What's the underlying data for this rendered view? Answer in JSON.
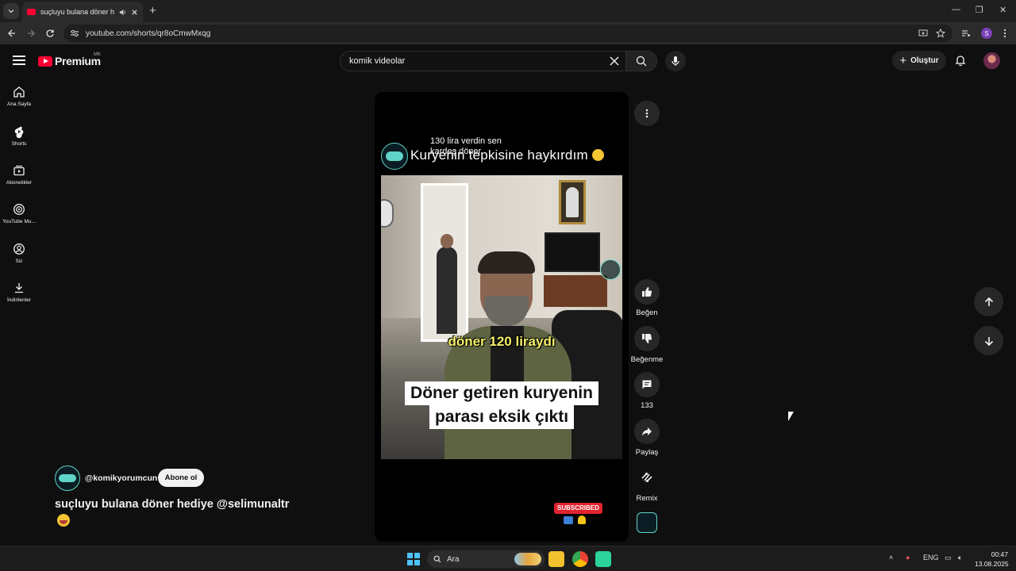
{
  "browser": {
    "tab_title": "suçluyu bulana döner hediy",
    "url": "youtube.com/shorts/qr8oCmwMxqg",
    "profile_initial": "S"
  },
  "header": {
    "brand": "Premium",
    "region": "MK",
    "search_value": "komik videolar",
    "create_label": "Oluştur"
  },
  "sidebar": {
    "items": [
      {
        "label": "Ana Sayfa",
        "icon": "home-icon"
      },
      {
        "label": "Shorts",
        "icon": "shorts-icon"
      },
      {
        "label": "Abonelikler",
        "icon": "subscriptions-icon"
      },
      {
        "label": "YouTube Mu...",
        "icon": "youtube-music-icon"
      },
      {
        "label": "Siz",
        "icon": "you-icon"
      },
      {
        "label": "İndirilenler",
        "icon": "downloads-icon"
      }
    ]
  },
  "video": {
    "overlay_text": "130 lira verdin sen kardeş döner",
    "title_text": "Kuryenin tepkisine haykırdım",
    "caption_yellow": "döner 120 liraydı",
    "caption_line1": "Döner getiren kuryenin",
    "caption_line2": "parası eksik çıktı",
    "subscribed_label": "SUBSCRIBED"
  },
  "actions": {
    "like_label": "Beğen",
    "dislike_label": "Beğenme",
    "comments_count": "133",
    "share_label": "Paylaş",
    "remix_label": "Remix"
  },
  "channel": {
    "handle": "@komikyorumcun",
    "subscribe_label": "Abone ol",
    "description": "suçluyu bulana döner hediye @selimunaltr"
  },
  "taskbar": {
    "search_placeholder": "Ara",
    "language": "ENG",
    "time": "00:47",
    "date": "13.08.2025"
  },
  "colors": {
    "background": "#0f0f0f",
    "brand_red": "#ff0033",
    "caption_yellow": "#f6f06a",
    "subscribed_red": "#e0242f",
    "windows_blue": "#4cc2ff"
  }
}
